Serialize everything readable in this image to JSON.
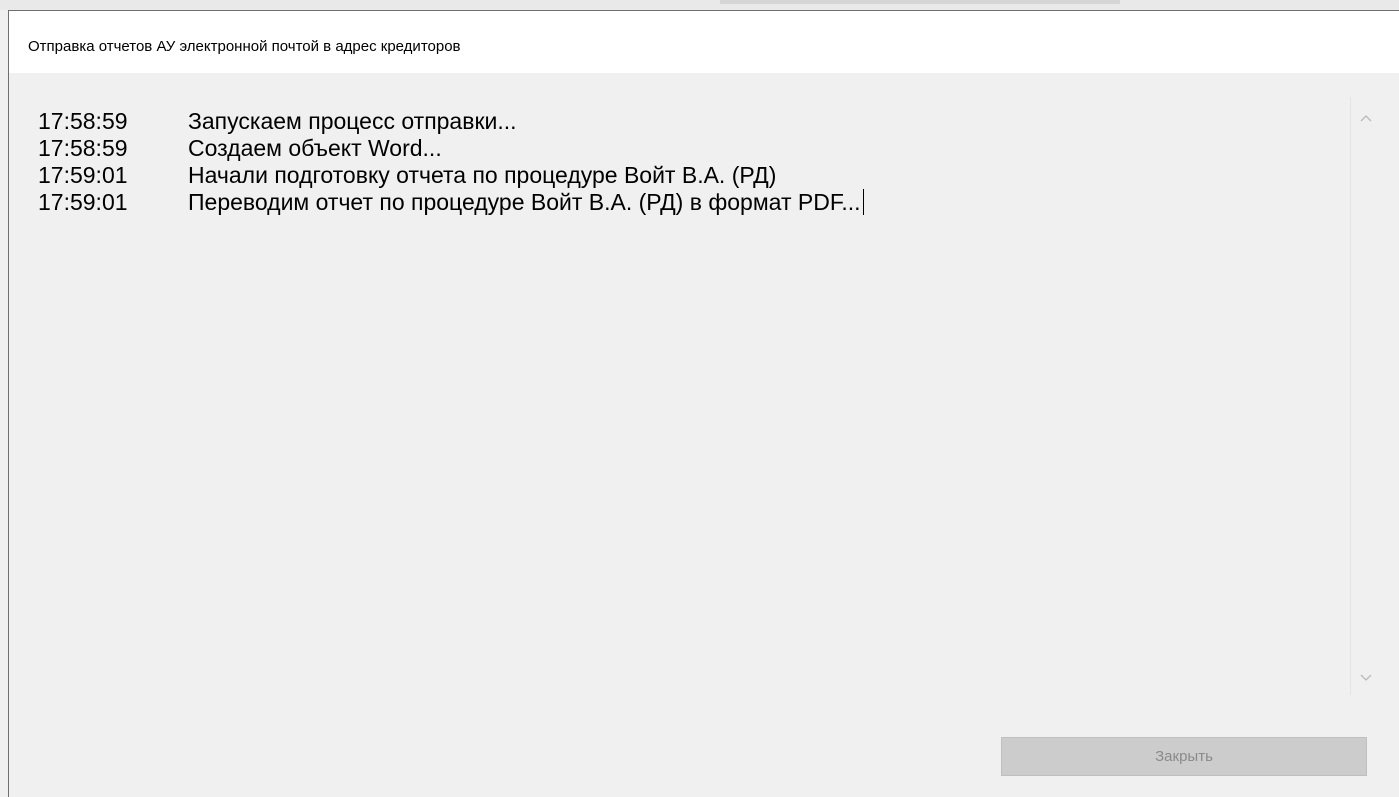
{
  "window": {
    "title": "Отправка отчетов АУ электронной почтой в адрес кредиторов"
  },
  "log": {
    "entries": [
      {
        "time": "17:58:59",
        "message": "Запускаем процесс отправки..."
      },
      {
        "time": "17:58:59",
        "message": "Создаем объект Word..."
      },
      {
        "time": "17:59:01",
        "message": "Начали подготовку отчета по процедуре Войт В.А. (РД)"
      },
      {
        "time": "17:59:01",
        "message": "Переводим отчет по процедуре Войт В.А. (РД) в формат PDF..."
      }
    ]
  },
  "scrollbar": {
    "up_icon": "chevron-up-icon",
    "down_icon": "chevron-down-icon"
  },
  "buttons": {
    "close_label": "Закрыть",
    "close_enabled": false
  },
  "colors": {
    "window_bg": "#f0f0f0",
    "titlebar_bg": "#ffffff",
    "disabled_button_bg": "#cccccc",
    "disabled_button_text": "#8a8a8a"
  }
}
